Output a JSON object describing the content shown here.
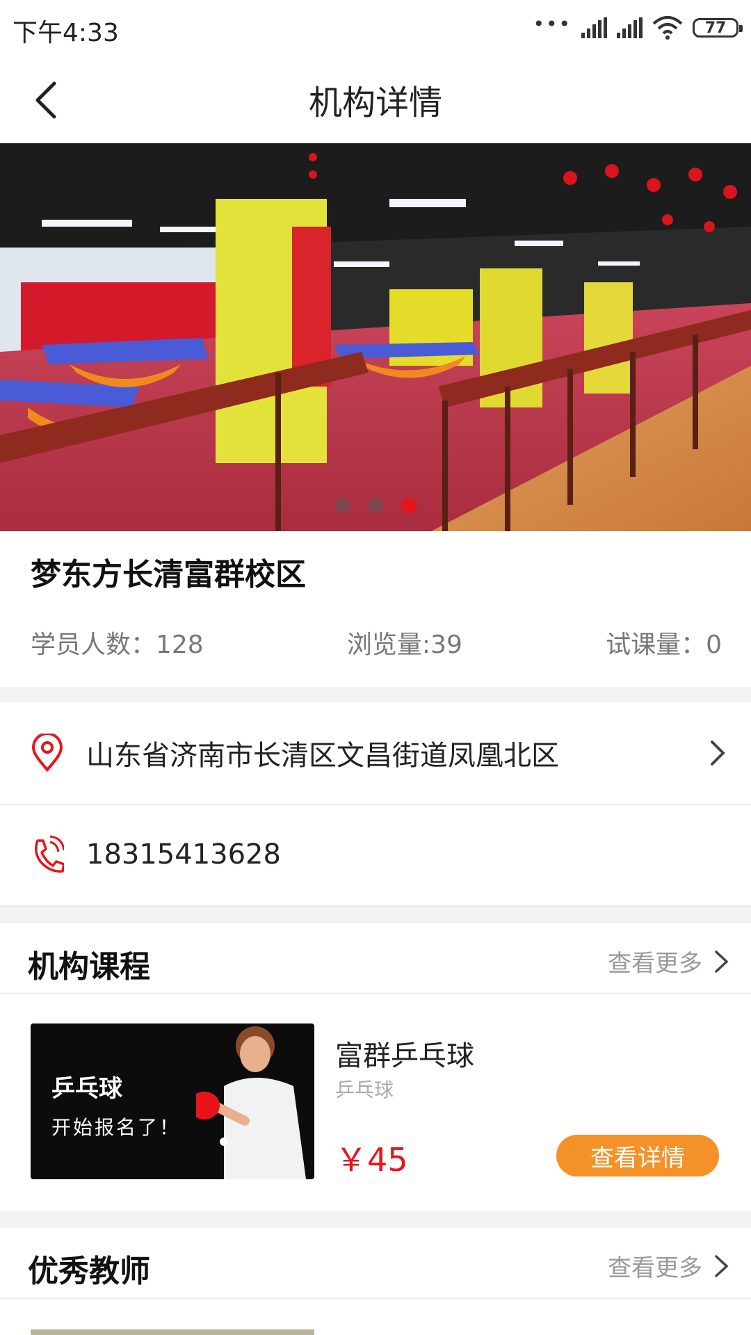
{
  "status_bar": {
    "time": "下午4:33",
    "battery": "77"
  },
  "header": {
    "title": "机构详情"
  },
  "banner": {
    "slide_count": 3,
    "active_slide": 3
  },
  "institution": {
    "name": "梦东方长清富群校区",
    "students_label": "学员人数：128",
    "views_label": "浏览量:39",
    "trials_label": "试课量：0",
    "address": "山东省济南市长清区文昌街道凤凰北区",
    "phone": "18315413628"
  },
  "courses_section": {
    "title": "机构课程",
    "more": "查看更多",
    "items": [
      {
        "thumb_title": "乒乓球",
        "thumb_subtitle": "开始报名了！",
        "name": "富群乒乓球",
        "tag": "乒乓球",
        "price": "￥45",
        "detail_button": "查看详情"
      }
    ]
  },
  "teachers_section": {
    "title": "优秀教师",
    "more": "查看更多"
  },
  "colors": {
    "accent_red": "#e8141a",
    "button_orange": "#f49129",
    "muted_text": "#777777"
  }
}
